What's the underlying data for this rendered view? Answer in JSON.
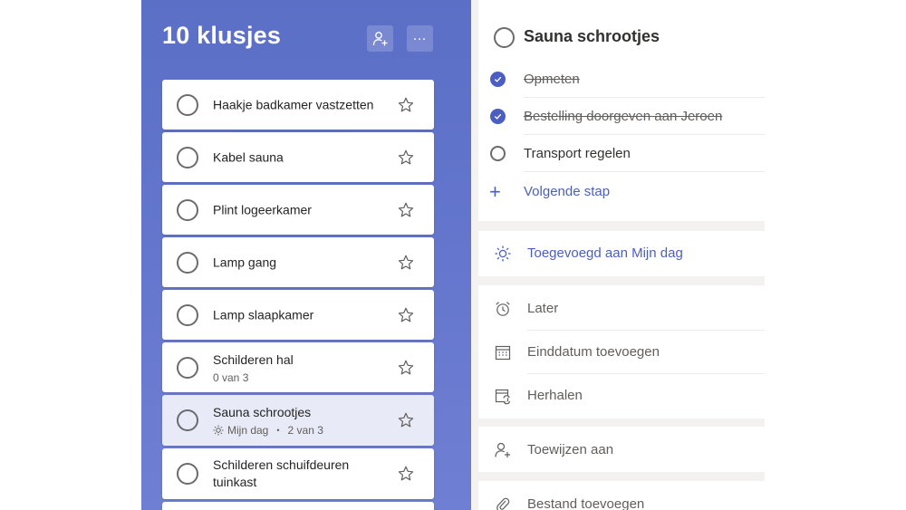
{
  "list": {
    "title": "10 klusjes",
    "tasks": [
      {
        "title": "Haakje badkamer vastzetten",
        "meta_text": "",
        "my_day": ""
      },
      {
        "title": "Kabel sauna",
        "meta_text": "",
        "my_day": ""
      },
      {
        "title": "Plint logeerkamer",
        "meta_text": "",
        "my_day": ""
      },
      {
        "title": "Lamp gang",
        "meta_text": "",
        "my_day": ""
      },
      {
        "title": "Lamp slaapkamer",
        "meta_text": "",
        "my_day": ""
      },
      {
        "title": "Schilderen hal",
        "meta_text": "0 van 3",
        "my_day": ""
      },
      {
        "title": "Sauna schrootjes",
        "meta_text": "2 van 3",
        "my_day": "Mijn dag"
      },
      {
        "title": "Schilderen schuifdeuren tuinkast",
        "meta_text": "",
        "my_day": ""
      }
    ],
    "meta_separator": "•"
  },
  "detail": {
    "title": "Sauna schrootjes",
    "steps": [
      {
        "label": "Opmeten",
        "completed": true
      },
      {
        "label": "Bestelling doorgeven aan Jeroen",
        "completed": true
      },
      {
        "label": "Transport regelen",
        "completed": false
      }
    ],
    "add_step_label": "Volgende stap",
    "my_day_label": "Toegevoegd aan Mijn dag",
    "reminder_label": "Later",
    "due_date_label": "Einddatum toevoegen",
    "repeat_label": "Herhalen",
    "assign_label": "Toewijzen aan",
    "attach_label": "Bestand toevoegen"
  },
  "icons": {
    "share": "person-add-icon",
    "more": "more-icon",
    "star": "star-icon",
    "sun": "sun-icon",
    "alarm": "alarm-icon",
    "calendar": "calendar-icon",
    "repeat": "repeat-icon",
    "assign": "person-add-icon",
    "attach": "paperclip-icon"
  },
  "colors": {
    "list_background": "#5b6fc6",
    "accent": "#4b5ec1",
    "selected_task": "#e8ebf7"
  }
}
